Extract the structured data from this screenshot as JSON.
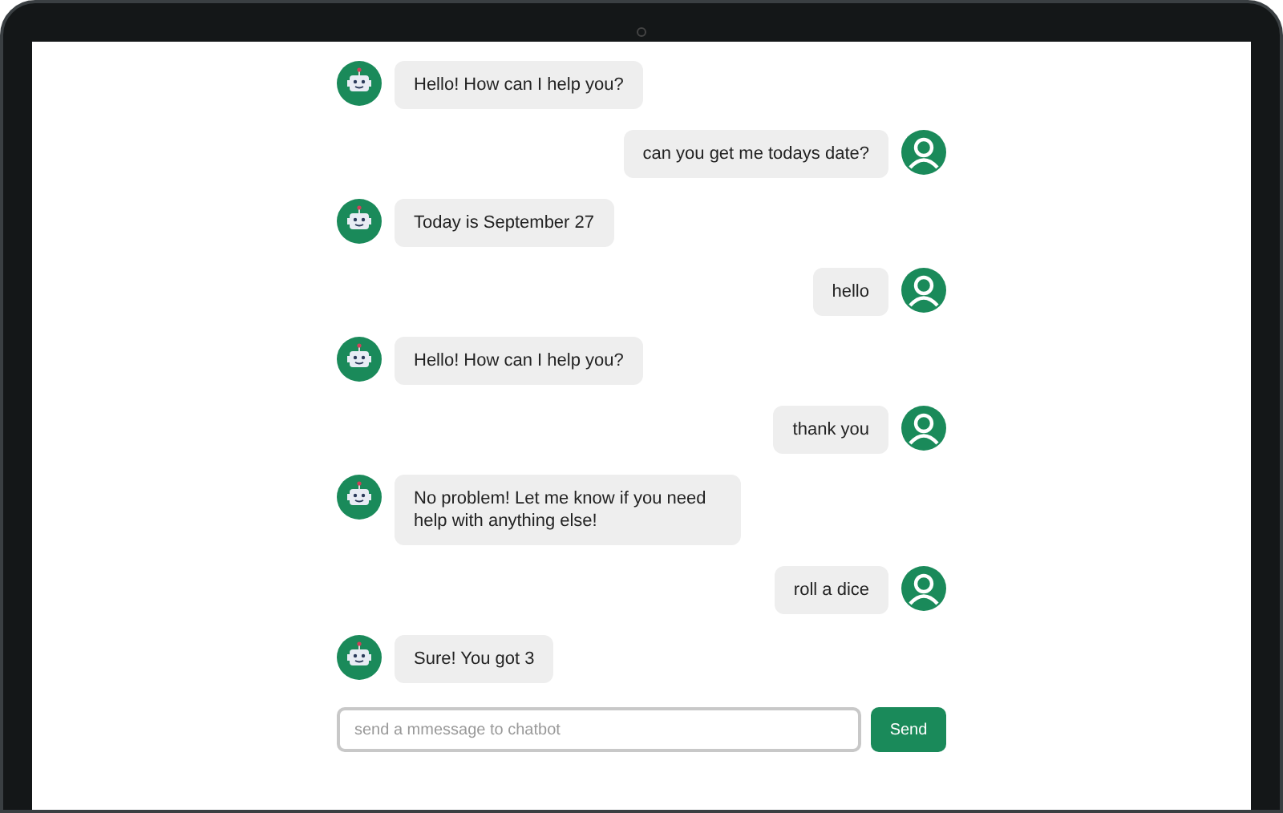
{
  "messages": [
    {
      "kind": "bot",
      "text": "Hello! How can I help you?"
    },
    {
      "kind": "user",
      "text": "can you get me todays date?"
    },
    {
      "kind": "bot",
      "text": "Today is September 27"
    },
    {
      "kind": "user",
      "text": "hello"
    },
    {
      "kind": "bot",
      "text": "Hello! How can I help you?"
    },
    {
      "kind": "user",
      "text": "thank you"
    },
    {
      "kind": "bot",
      "text": "No problem! Let me know if you need help with anything else!"
    },
    {
      "kind": "user",
      "text": "roll a dice"
    },
    {
      "kind": "bot",
      "text": "Sure! You got 3"
    }
  ],
  "composer": {
    "placeholder": "send a mmessage to chatbot",
    "button": "Send"
  }
}
